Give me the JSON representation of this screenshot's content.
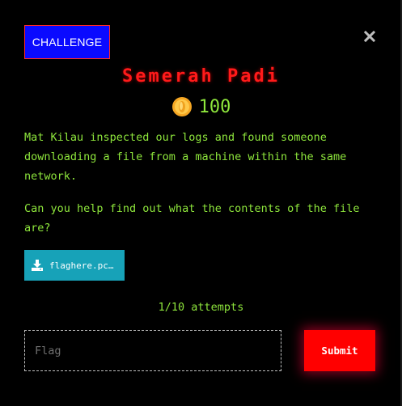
{
  "modal": {
    "category_tag": "CHALLENGE",
    "close_icon": "close-x-icon",
    "title": "Semerah Padi",
    "points_icon": "gold-coin-icon",
    "points": "100",
    "description": [
      "Mat Kilau inspected our logs and found someone downloading a file from a machine within the same network.",
      "Can you help find out what the contents of the file are?"
    ],
    "attachment": {
      "icon": "download-icon",
      "filename": "flaghere.pcap"
    },
    "attempts": "1/10 attempts",
    "flag_input": {
      "placeholder": "Flag",
      "value": ""
    },
    "submit_label": "Submit"
  },
  "colors": {
    "background": "#000000",
    "tag_bg": "#0a0aff",
    "title": "#ff1a1a",
    "text_green": "#8ee63c",
    "file_btn": "#17a2b8",
    "submit": "#ff0000"
  }
}
